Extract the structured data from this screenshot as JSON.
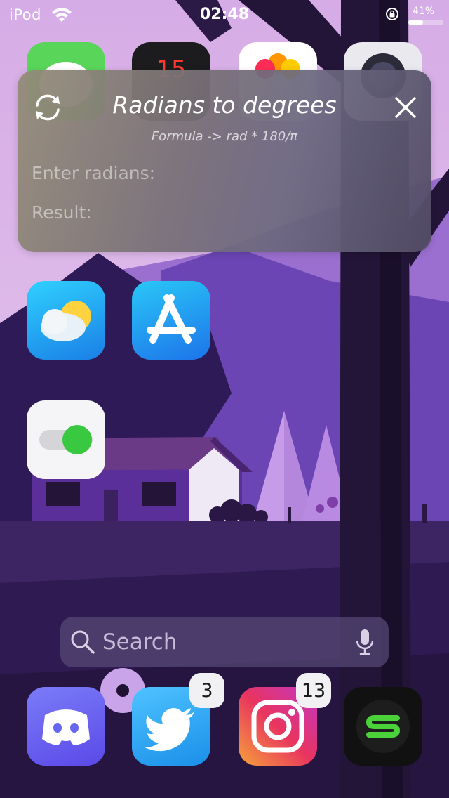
{
  "status_bar": {
    "device": "iPod",
    "time": "02:48",
    "battery_percent_label": "41%",
    "battery_level": 0.41,
    "icons": [
      "wifi-icon",
      "orientation-lock-icon",
      "battery-icon"
    ]
  },
  "top_row_apps": [
    {
      "name": "messages-app-icon",
      "color": "#4cd964"
    },
    {
      "name": "calendar-app-icon",
      "color": "#1c1c1e",
      "partial_text": "15"
    },
    {
      "name": "photos-app-icon",
      "color": "#ffffff"
    },
    {
      "name": "camera-app-icon",
      "color": "#e9e9ee"
    }
  ],
  "widget": {
    "title": "Radians to degrees",
    "formula": "Formula -> rad * 180/π",
    "input_placeholder": "Enter radians:",
    "result_label": "Result:",
    "refresh_icon": "refresh-icon",
    "close_icon": "close-icon"
  },
  "apps": [
    {
      "name": "weather-app-icon",
      "color": "#1fa9f2"
    },
    {
      "name": "app-store-app-icon",
      "color": "#1a9bf5"
    },
    {
      "name": "settings-toggle-app-icon",
      "color": "#f4f4f6"
    }
  ],
  "search": {
    "placeholder": "Search"
  },
  "dock": [
    {
      "name": "discord-app-icon",
      "color": "#6b6cf3",
      "badge": ""
    },
    {
      "name": "twitter-app-icon",
      "color": "#1da1f2",
      "badge": "3"
    },
    {
      "name": "instagram-app-icon",
      "color": "#e1306c",
      "badge": "13"
    },
    {
      "name": "sileo-app-icon",
      "color": "#111111",
      "badge": ""
    }
  ],
  "colors": {
    "wallpaper_sky": "#d9b8e6",
    "wallpaper_purple": "#6a47b0",
    "wallpaper_dark": "#24163f",
    "widget_text": "#ffffff"
  }
}
